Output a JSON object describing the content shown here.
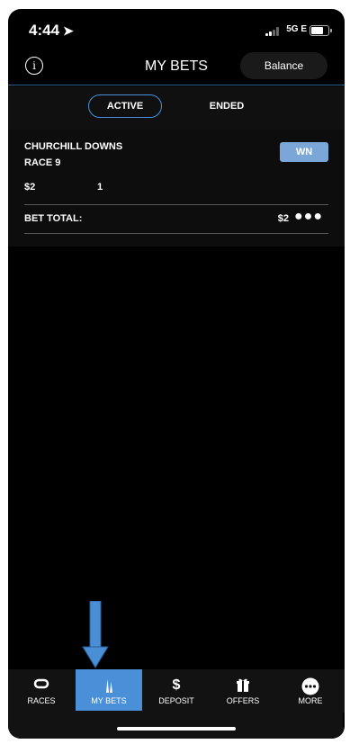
{
  "status_bar": {
    "time": "4:44",
    "network": "5G E"
  },
  "header": {
    "title": "MY BETS",
    "balance_label": "Balance"
  },
  "tabs": [
    {
      "label": "ACTIVE",
      "selected": true
    },
    {
      "label": "ENDED",
      "selected": false
    }
  ],
  "bet": {
    "track": "CHURCHILL DOWNS",
    "race": "RACE 9",
    "bet_type": "WN",
    "amount": "$2",
    "selection": "1",
    "total_label": "BET TOTAL:",
    "total_value": "$2"
  },
  "nav": [
    {
      "label": "RACES",
      "icon": "races-icon"
    },
    {
      "label": "MY BETS",
      "icon": "my-bets-icon",
      "active": true
    },
    {
      "label": "DEPOSIT",
      "icon": "dollar-icon"
    },
    {
      "label": "OFFERS",
      "icon": "gift-icon"
    },
    {
      "label": "MORE",
      "icon": "more-icon"
    }
  ],
  "colors": {
    "accent": "#4a90d9",
    "badge": "#7ba7d8",
    "background": "#000000"
  }
}
